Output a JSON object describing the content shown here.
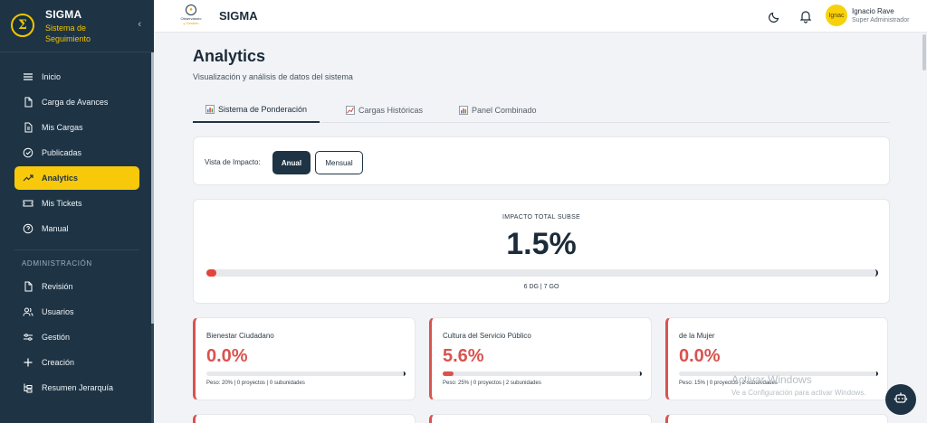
{
  "sidebar": {
    "brand_title": "SIGMA",
    "brand_subtitle": "Sistema de Seguimiento",
    "logo_glyph": "Σ",
    "items": [
      {
        "label": "Inicio",
        "icon": "menu-icon"
      },
      {
        "label": "Carga de Avances",
        "icon": "file-icon"
      },
      {
        "label": "Mis Cargas",
        "icon": "file-text-icon"
      },
      {
        "label": "Publicadas",
        "icon": "check-circle-icon"
      },
      {
        "label": "Analytics",
        "icon": "trending-up-icon",
        "active": true
      },
      {
        "label": "Mis Tickets",
        "icon": "ticket-icon"
      },
      {
        "label": "Manual",
        "icon": "help-circle-icon"
      }
    ],
    "section_admin": "ADMINISTRACIÓN",
    "admin_items": [
      {
        "label": "Revisión",
        "icon": "file-icon"
      },
      {
        "label": "Usuarios",
        "icon": "users-icon"
      },
      {
        "label": "Gestión",
        "icon": "sliders-icon"
      },
      {
        "label": "Creación",
        "icon": "plus-icon"
      },
      {
        "label": "Resumen Jerarquía",
        "icon": "hierarchy-icon"
      }
    ]
  },
  "topbar": {
    "title": "SIGMA",
    "logo_text_1": "Observatorio",
    "logo_text_2": "y Gestión",
    "user_name": "Ignacio Rave",
    "user_role": "Super Administrador",
    "avatar_text": "Ignac"
  },
  "page": {
    "title": "Analytics",
    "subtitle": "Visualización y análisis de datos del sistema",
    "tabs": [
      {
        "label": "Sistema de Ponderación",
        "icon": "bar-chart-icon",
        "active": true
      },
      {
        "label": "Cargas Históricas",
        "icon": "line-chart-icon"
      },
      {
        "label": "Panel Combinado",
        "icon": "bar-chart-icon"
      }
    ]
  },
  "view": {
    "label": "Vista de Impacto:",
    "annual": "Anual",
    "monthly": "Mensual"
  },
  "impact": {
    "label": "IMPACTO TOTAL SUBSE",
    "value": "1.5%",
    "fraction": 0.015,
    "detail": "6 DG | 7 GO"
  },
  "subunits": [
    {
      "name": "Bienestar Ciudadano",
      "value": "0.0%",
      "fraction": 0.0,
      "meta": "Peso: 20% | 0 proyectos | 0 subunidades"
    },
    {
      "name": "Cultura del Servicio Público",
      "value": "5.6%",
      "fraction": 0.056,
      "meta": "Peso: 25% | 0 proyectos | 2 subunidades"
    },
    {
      "name": "de la Mujer",
      "value": "0.0%",
      "fraction": 0.0,
      "meta": "Peso: 15% | 0 proyectos | 2 subunidades"
    }
  ],
  "colors": {
    "sidebar_bg": "#1e3445",
    "accent": "#f8c80b",
    "danger": "#d9534f"
  },
  "watermark": {
    "line1": "Activar Windows",
    "line2": "Ve a Configuración para activar Windows."
  }
}
